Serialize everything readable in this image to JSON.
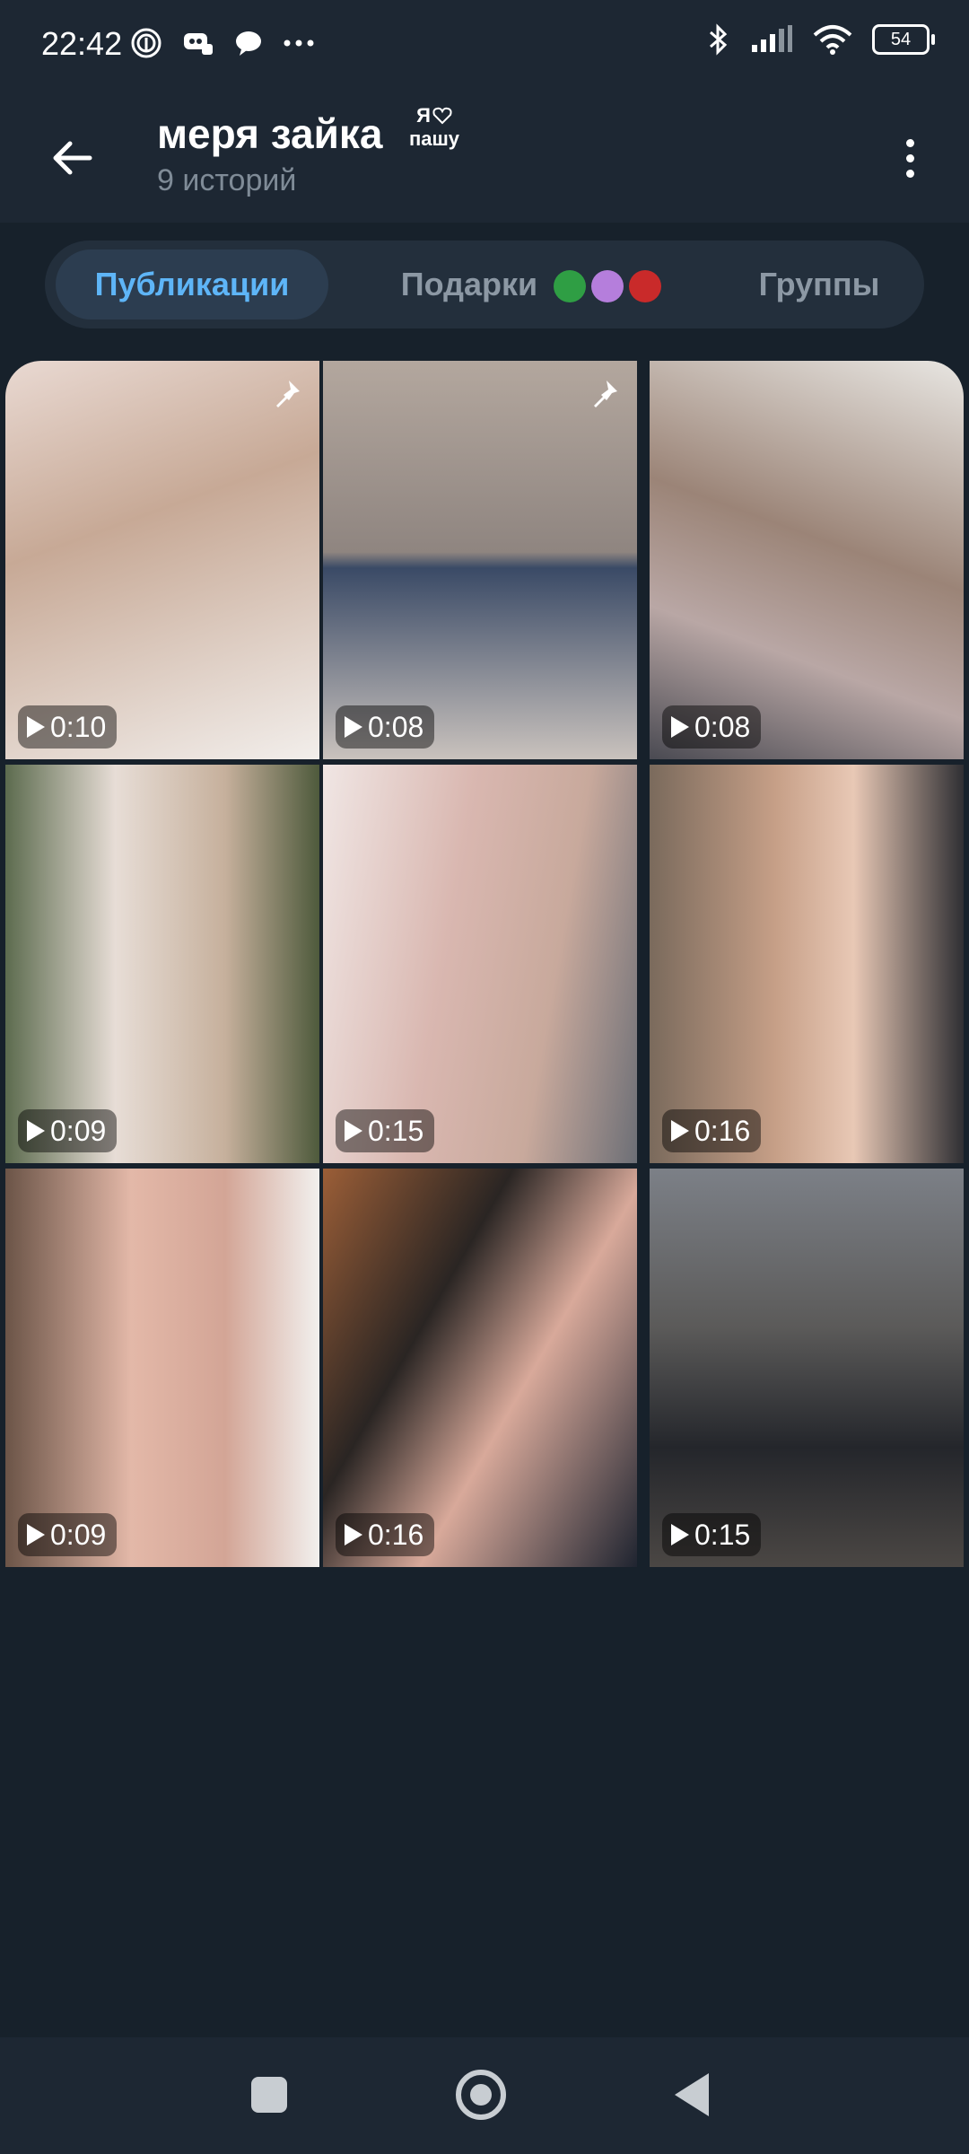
{
  "status": {
    "time": "22:42",
    "battery": "54"
  },
  "header": {
    "title": "меря зайка",
    "title_suffix_top": "Я",
    "title_suffix_bottom": "пашу",
    "subtitle": "9 историй"
  },
  "tabs": [
    {
      "label": "Публикации",
      "active": true
    },
    {
      "label": "Подарки",
      "active": false
    },
    {
      "label": "Группы",
      "active": false
    }
  ],
  "stories": [
    {
      "duration": "0:10",
      "pinned": true,
      "color": "#d8c3b8"
    },
    {
      "duration": "0:08",
      "pinned": true,
      "color": "#a99b92"
    },
    {
      "duration": "0:08",
      "pinned": false,
      "color": "#9c8d82"
    },
    {
      "duration": "0:09",
      "pinned": false,
      "color": "#8b8f7a"
    },
    {
      "duration": "0:15",
      "pinned": false,
      "color": "#c9b5ad"
    },
    {
      "duration": "0:16",
      "pinned": false,
      "color": "#a88f80"
    },
    {
      "duration": "0:09",
      "pinned": false,
      "color": "#b49a8c"
    },
    {
      "duration": "0:16",
      "pinned": false,
      "color": "#6f4f3e"
    },
    {
      "duration": "0:15",
      "pinned": false,
      "color": "#5d5a58"
    }
  ]
}
